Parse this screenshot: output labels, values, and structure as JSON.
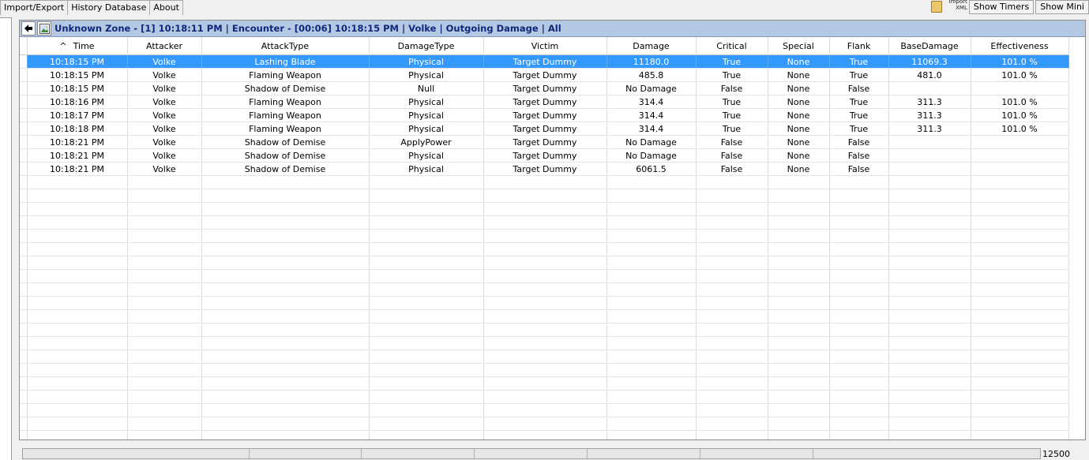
{
  "tabs": [
    "Import/Export",
    "History Database",
    "About"
  ],
  "topbar": {
    "import_xml": "Import XML",
    "show_timers": "Show Timers",
    "show_mini": "Show Mini"
  },
  "panel": {
    "title": "Unknown Zone - [1] 10:18:11 PM | Encounter - [00:06] 10:18:15 PM | Volke | Outgoing Damage | All"
  },
  "table": {
    "sort_indicator": "^",
    "columns": [
      "Time",
      "Attacker",
      "AttackType",
      "DamageType",
      "Victim",
      "Damage",
      "Critical",
      "Special",
      "Flank",
      "BaseDamage",
      "Effectiveness"
    ],
    "rows": [
      [
        "10:18:15 PM",
        "Volke",
        "Lashing Blade",
        "Physical",
        "Target Dummy",
        "11180.0",
        "True",
        "None",
        "True",
        "11069.3",
        "101.0 %"
      ],
      [
        "10:18:15 PM",
        "Volke",
        "Flaming Weapon",
        "Physical",
        "Target Dummy",
        "485.8",
        "True",
        "None",
        "True",
        "481.0",
        "101.0 %"
      ],
      [
        "10:18:15 PM",
        "Volke",
        "Shadow of Demise",
        "Null",
        "Target Dummy",
        "No Damage",
        "False",
        "None",
        "False",
        "",
        ""
      ],
      [
        "10:18:16 PM",
        "Volke",
        "Flaming Weapon",
        "Physical",
        "Target Dummy",
        "314.4",
        "True",
        "None",
        "True",
        "311.3",
        "101.0 %"
      ],
      [
        "10:18:17 PM",
        "Volke",
        "Flaming Weapon",
        "Physical",
        "Target Dummy",
        "314.4",
        "True",
        "None",
        "True",
        "311.3",
        "101.0 %"
      ],
      [
        "10:18:18 PM",
        "Volke",
        "Flaming Weapon",
        "Physical",
        "Target Dummy",
        "314.4",
        "True",
        "None",
        "True",
        "311.3",
        "101.0 %"
      ],
      [
        "10:18:21 PM",
        "Volke",
        "Shadow of Demise",
        "ApplyPower",
        "Target Dummy",
        "No Damage",
        "False",
        "None",
        "False",
        "",
        ""
      ],
      [
        "10:18:21 PM",
        "Volke",
        "Shadow of Demise",
        "Physical",
        "Target Dummy",
        "No Damage",
        "False",
        "None",
        "False",
        "",
        ""
      ],
      [
        "10:18:21 PM",
        "Volke",
        "Shadow of Demise",
        "Physical",
        "Target Dummy",
        "6061.5",
        "False",
        "None",
        "False",
        "",
        ""
      ]
    ],
    "selected_row": 0
  },
  "status": {
    "value": "12500"
  },
  "colors": {
    "selection": "#3399ff",
    "title_bar": "#b4c8e4",
    "title_text": "#10287a"
  }
}
